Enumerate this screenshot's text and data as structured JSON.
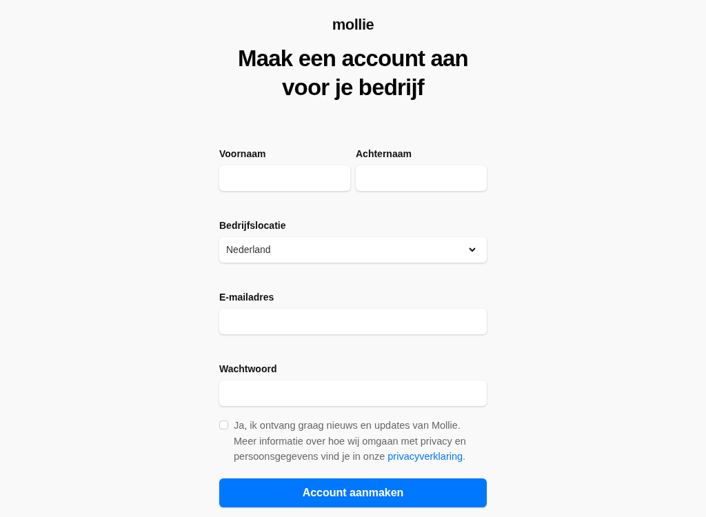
{
  "logo": "mollie",
  "title": "Maak een account aan voor je bedrijf",
  "name_fields": [
    {
      "label": "Voornaam"
    },
    {
      "label": "Achternaam"
    }
  ],
  "location": {
    "label": "Bedrijfslocatie",
    "value": "Nederland"
  },
  "email": {
    "label": "E-mailadres"
  },
  "password": {
    "label": "Wachtwoord"
  },
  "newsletter": {
    "checked": false,
    "text": "Ja, ik ontvang graag nieuws en updates van Mollie. Meer informatie over hoe wij omgaan met privacy en persoonsgegevens vind je in onze",
    "link": "privacyverklaring",
    "after": "."
  },
  "submit": "Account aanmaken"
}
